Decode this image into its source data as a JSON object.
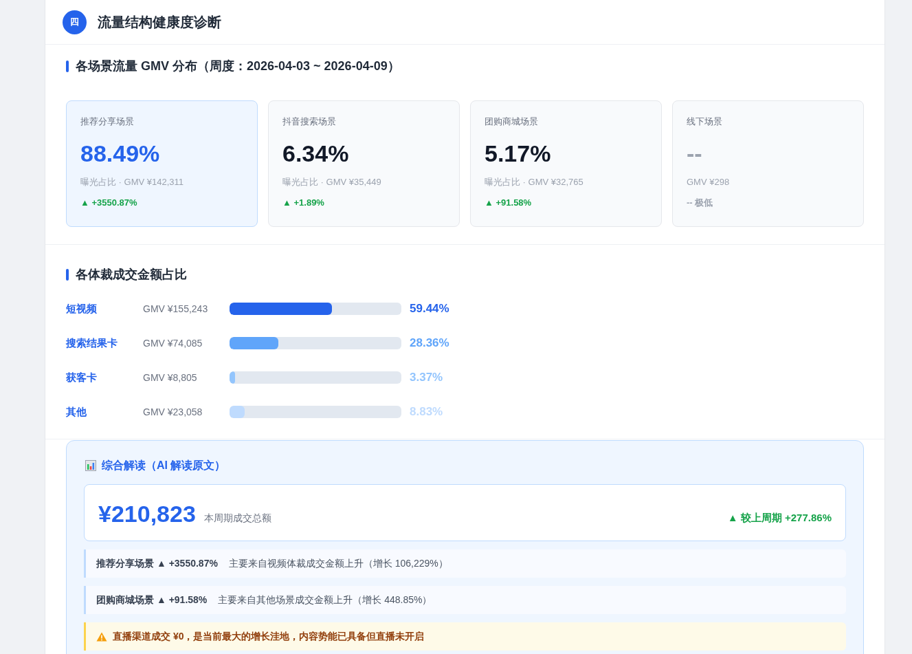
{
  "section": {
    "badge": "四",
    "title": "流量结构健康度诊断"
  },
  "scene_block": {
    "title": "各场景流量 GMV 分布（周度：2026-04-03 ~ 2026-04-09）",
    "cards": [
      {
        "name": "推荐分享场景",
        "value": "88.49%",
        "meta": "曝光占比 · GMV ¥142,311",
        "delta": "▲ +3550.87%",
        "selected": true,
        "up": true
      },
      {
        "name": "抖音搜索场景",
        "value": "6.34%",
        "meta": "曝光占比 · GMV ¥35,449",
        "delta": "▲ +1.89%",
        "selected": false,
        "up": true
      },
      {
        "name": "团购商城场景",
        "value": "5.17%",
        "meta": "曝光占比 · GMV ¥32,765",
        "delta": "▲ +91.58%",
        "selected": false,
        "up": true
      },
      {
        "name": "线下场景",
        "value": "--",
        "meta": "GMV ¥298",
        "delta": "-- 极低",
        "selected": false,
        "up": false
      }
    ]
  },
  "format_block": {
    "title": "各体裁成交金额占比",
    "rows": [
      {
        "name": "短视频",
        "gmv": "GMV ¥155,243",
        "level": 0.5944,
        "share": "59.44%",
        "color": "#2563eb"
      },
      {
        "name": "搜索结果卡",
        "gmv": "GMV ¥74,085",
        "level": 0.2836,
        "share": "28.36%",
        "color": "#60a5fa"
      },
      {
        "name": "获客卡",
        "gmv": "GMV ¥8,805",
        "level": 0.0337,
        "share": "3.37%",
        "color": "#93c5fd"
      },
      {
        "name": "其他",
        "gmv": "GMV ¥23,058",
        "level": 0.0883,
        "share": "8.83%",
        "color": "#bfdbfe"
      }
    ]
  },
  "summary": {
    "title": "综合解读（AI 解读原文）",
    "total": "¥210,823",
    "total_label": "本周期成交总额",
    "change": "▲ 较上周期 +277.86%",
    "items": [
      {
        "kind": "reason",
        "head": "推荐分享场景 ▲ +3550.87%",
        "text": "主要来自视频体裁成交金额上升（增长 106,229%）"
      },
      {
        "kind": "reason",
        "head": "团购商城场景 ▲ +91.58%",
        "text": "主要来自其他场景成交金额上升（增长 448.85%）"
      },
      {
        "kind": "warning",
        "text": "直播渠道成交 ¥0，是当前最大的增长洼地，内容势能已具备但直播未开启"
      }
    ]
  }
}
